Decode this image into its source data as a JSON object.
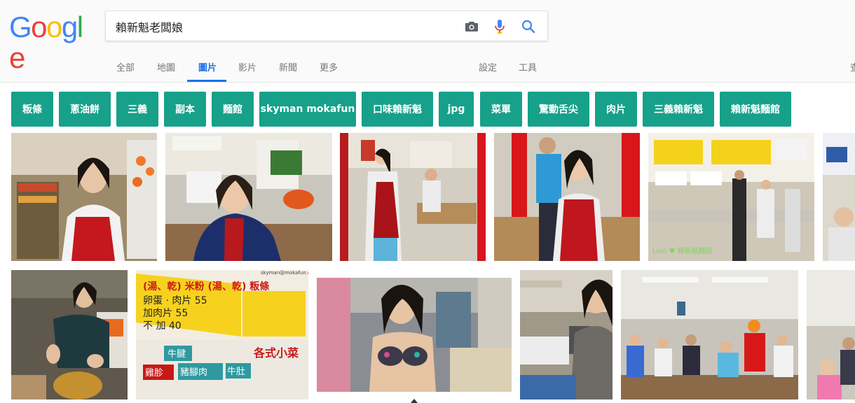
{
  "logo": {
    "letters": [
      "G",
      "o",
      "o",
      "g",
      "l",
      "e"
    ],
    "colors": [
      "#4285f4",
      "#ea4335",
      "#fbbc05",
      "#4285f4",
      "#34a853",
      "#ea4335"
    ]
  },
  "search": {
    "query": "賴新魁老闆娘",
    "camera_icon": "camera-icon",
    "mic_icon": "microphone-icon",
    "search_icon": "search-icon"
  },
  "nav": {
    "tabs": [
      "全部",
      "地圖",
      "圖片",
      "影片",
      "新聞",
      "更多"
    ],
    "active_tab": "圖片",
    "settings": "設定",
    "tools": "工具",
    "cut_off": "查"
  },
  "chips": [
    "粄條",
    "蔥油餅",
    "三義",
    "副本",
    "麵館",
    "skyman mokafun",
    "口味賴新魁",
    "jpg",
    "菜單",
    "驚動舌尖",
    "肉片",
    "三義賴新魁",
    "賴新魁麵館"
  ],
  "images": {
    "sign1": {
      "line1": "(湯、乾) 米粉 (湯、乾) 粄條",
      "line2": "卵蛋 · 肉片 55",
      "line3": "加肉片 55",
      "line4": "不 加 40",
      "tags": [
        "牛腱",
        "雞胗",
        "豬腳肉",
        "牛肚",
        "各式小菜"
      ],
      "watermark": "skyman@mokafun.com"
    },
    "shop_caption": "Lolo ♥ 賴新魁麵館"
  },
  "colors": {
    "accent": "#1a73e8",
    "chip": "#17a08a"
  }
}
